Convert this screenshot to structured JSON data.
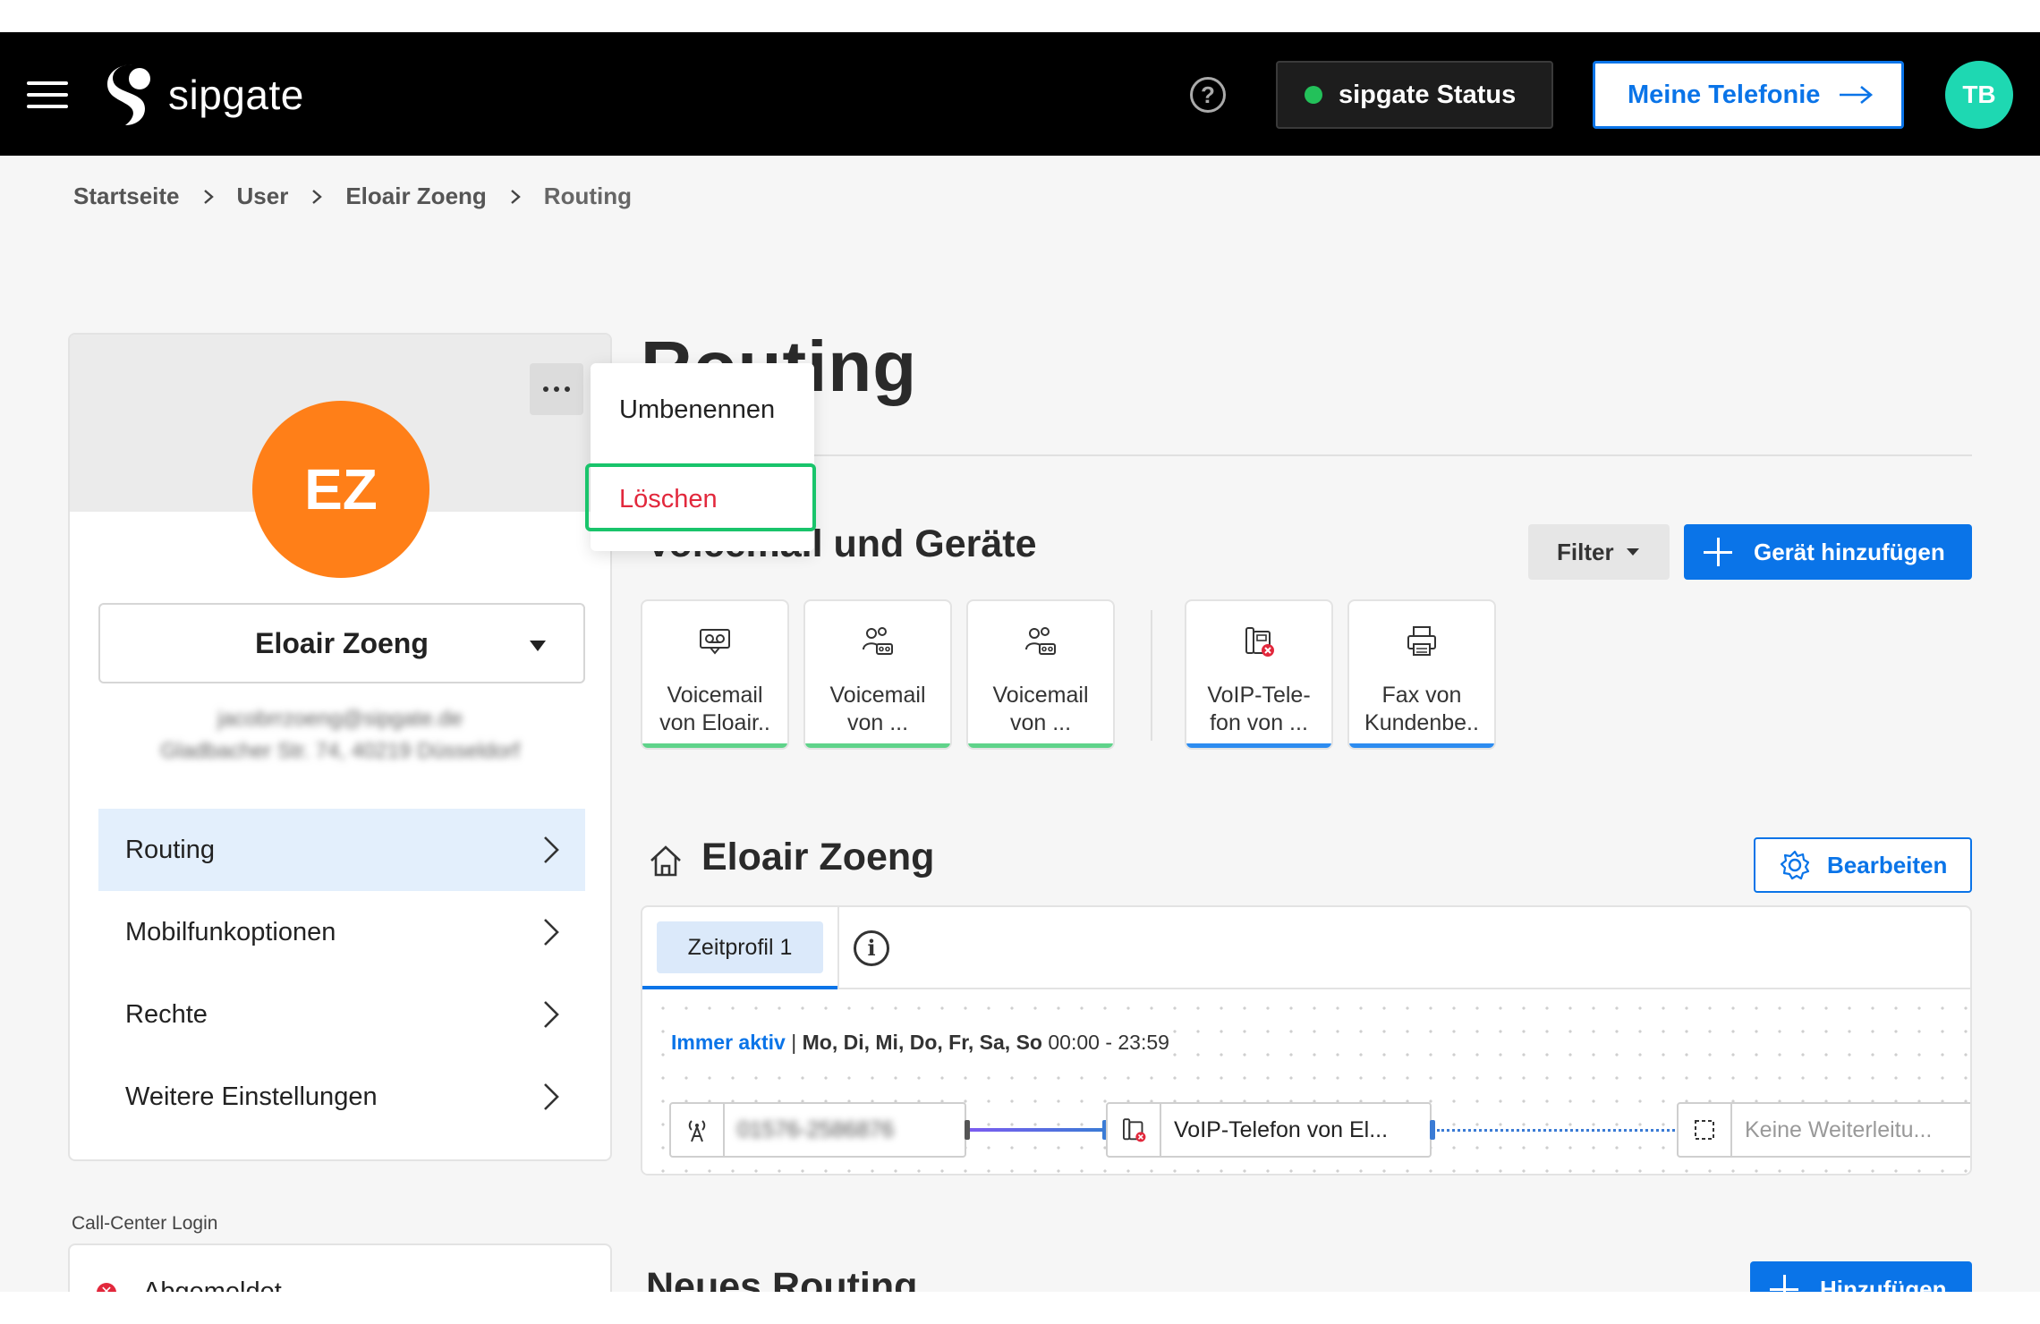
{
  "topbar": {
    "logo_text": "sipgate",
    "help_label": "?",
    "status_label": "sipgate Status",
    "status_color": "#23c15a",
    "telefonie_label": "Meine Telefonie",
    "user_initials": "TB",
    "user_avatar_color": "#1ed8b2",
    "accent_color": "#0a74e8"
  },
  "breadcrumb": [
    "Startseite",
    "User",
    "Eloair Zoeng",
    "Routing"
  ],
  "user_card": {
    "initials": "EZ",
    "avatar_color": "#ff7f18",
    "name": "Eloair Zoeng",
    "email_blurred": "jacobrrzoeng@sipgate.de",
    "address_blurred": "Gladbacher Str. 74, 40219 Düsseldorf",
    "nav": [
      {
        "label": "Routing",
        "active": true
      },
      {
        "label": "Mobilfunkoptionen",
        "active": false
      },
      {
        "label": "Rechte",
        "active": false
      },
      {
        "label": "Weitere Einstellungen",
        "active": false
      }
    ]
  },
  "menu": {
    "rename": "Umbenennen",
    "delete": "Löschen"
  },
  "call_center": {
    "label": "Call-Center Login",
    "status": "Abgemeldet"
  },
  "page_title": "Routing",
  "devices_section": {
    "title": "Voicemail und Geräte",
    "filter_label": "Filter",
    "add_label": "Gerät hinzufügen",
    "devices": [
      {
        "icon": "voicemail-icon",
        "line1": "Voicemail",
        "line2": "von Eloair..",
        "bar_color": "#5fd38a"
      },
      {
        "icon": "group-voicemail-icon",
        "line1": "Voicemail",
        "line2": "von ...",
        "bar_color": "#5fd38a"
      },
      {
        "icon": "group-voicemail-icon",
        "line1": "Voicemail",
        "line2": "von ...",
        "bar_color": "#5fd38a"
      },
      {
        "icon": "voip-phone-icon",
        "line1": "VoIP-Tele-",
        "line2": "fon von ...",
        "bar_color": "#2d8cf0"
      },
      {
        "icon": "fax-icon",
        "line1": "Fax von",
        "line2": "Kundenbe..",
        "bar_color": "#2d8cf0"
      }
    ]
  },
  "routing_section": {
    "title": "Eloair Zoeng",
    "edit_label": "Bearbeiten",
    "tab_label": "Zeitprofil 1",
    "info_label": "i",
    "schedule_active": "Immer aktiv",
    "schedule_sep": " | ",
    "schedule_days": "Mo, Di, Mi, Do, Fr, Sa, So",
    "schedule_time": " 00:00 - 23:59",
    "source_number_blurred": "01576-2586876",
    "target_device": "VoIP-Telefon von El...",
    "forward_placeholder": "Keine Weiterleitu..."
  },
  "new_routing": {
    "title": "Neues Routing",
    "add_label": "Hinzufügen"
  }
}
